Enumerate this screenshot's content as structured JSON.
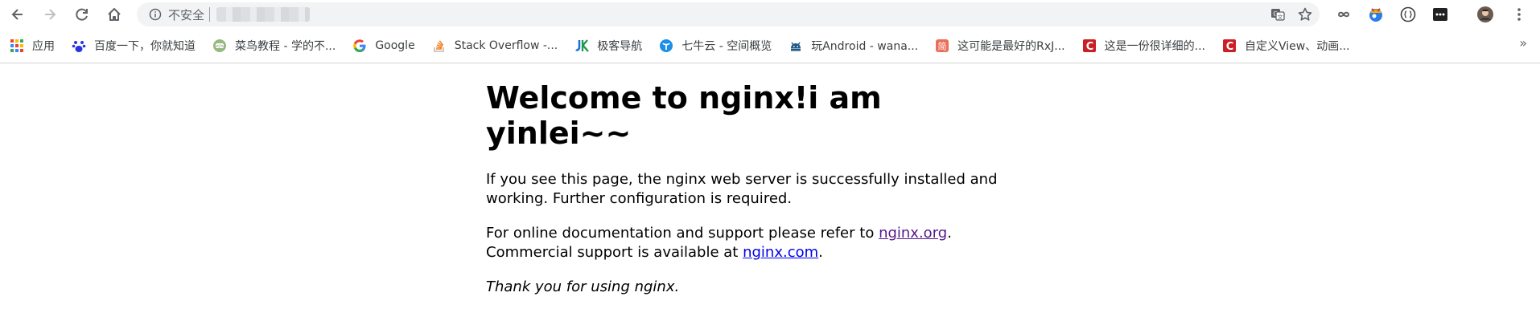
{
  "toolbar": {
    "security_label": "不安全"
  },
  "bookmarks": [
    {
      "label": "应用",
      "icon": "apps-grid-icon"
    },
    {
      "label": "百度一下，你就知道",
      "icon": "baidu-paw-icon"
    },
    {
      "label": "菜鸟教程 - 学的不...",
      "icon": "runoob-icon"
    },
    {
      "label": "Google",
      "icon": "google-icon"
    },
    {
      "label": "Stack Overflow -...",
      "icon": "stackoverflow-icon"
    },
    {
      "label": "极客导航",
      "icon": "jike-icon"
    },
    {
      "label": "七牛云 - 空间概览",
      "icon": "qiniu-icon"
    },
    {
      "label": "玩Android - wana...",
      "icon": "android-icon"
    },
    {
      "label": "这可能是最好的RxJ...",
      "icon": "jianshu-icon"
    },
    {
      "label": "这是一份很详细的...",
      "icon": "csdn-icon"
    },
    {
      "label": "自定义View、动画...",
      "icon": "csdn-icon"
    }
  ],
  "bookmarks_more": "»",
  "page": {
    "title": "Welcome to nginx!i am yinlei~~",
    "para1": "If you see this page, the nginx web server is successfully installed and working. Further configuration is required.",
    "para2_prefix": "For online documentation and support please refer to ",
    "link_org": "nginx.org",
    "para2_suffix": ".",
    "para2_line2_prefix": "Commercial support is available at ",
    "link_com": "nginx.com",
    "para2_line2_suffix": ".",
    "thanks": "Thank you for using nginx."
  },
  "colors": {
    "visited_link": "#551a8b",
    "link": "#0000ee",
    "omnibox_bg": "#f1f3f4"
  }
}
